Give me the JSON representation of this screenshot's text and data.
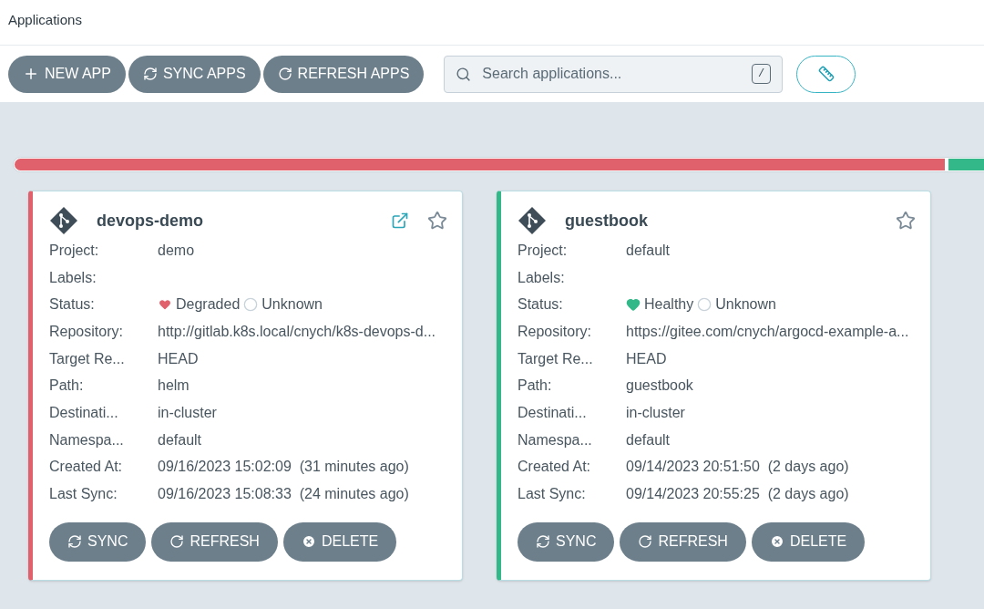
{
  "header": {
    "title": "Applications"
  },
  "toolbar": {
    "buttons": [
      {
        "kind": "new",
        "label": "NEW APP"
      },
      {
        "kind": "sync",
        "label": "SYNC APPS"
      },
      {
        "kind": "refresh",
        "label": "REFRESH APPS"
      }
    ],
    "search": {
      "placeholder": "Search applications...",
      "shortcut": "/"
    }
  },
  "health_bar": [
    {
      "color": "#e0616b",
      "level": 0.5
    },
    {
      "color": "#33b889",
      "level": 0.5
    }
  ],
  "apps": [
    {
      "name": "devops-demo",
      "color": "#e0616b",
      "external_link": true,
      "favorite": false,
      "rows": [
        {
          "kind": "text",
          "label": "Project:",
          "value": "demo"
        },
        {
          "kind": "text",
          "label": "Labels:"
        },
        {
          "kind": "status",
          "label": "Status:",
          "health": {
            "kind": "degraded",
            "label": "Degraded"
          },
          "sync": "Unknown"
        },
        {
          "kind": "text",
          "label": "Repository:",
          "value": "http://gitlab.k8s.local/cnych/k8s-devops-d..."
        },
        {
          "kind": "text",
          "label": "Target Re...",
          "value": "HEAD"
        },
        {
          "kind": "text",
          "label": "Path:",
          "value": "helm"
        },
        {
          "kind": "text",
          "label": "Destinati...",
          "value": "in-cluster"
        },
        {
          "kind": "text",
          "label": "Namespa...",
          "value": "default"
        },
        {
          "kind": "text",
          "label": "Created At:",
          "value": "09/16/2023 15:02:09  (31 minutes ago)"
        },
        {
          "kind": "text",
          "label": "Last Sync:",
          "value": "09/16/2023 15:08:33  (24 minutes ago)"
        }
      ],
      "actions": [
        {
          "kind": "sync",
          "label": "SYNC"
        },
        {
          "kind": "refresh",
          "label": "REFRESH"
        },
        {
          "kind": "delete",
          "label": "DELETE"
        }
      ]
    },
    {
      "name": "guestbook",
      "color": "#33b889",
      "external_link": false,
      "favorite": false,
      "rows": [
        {
          "kind": "text",
          "label": "Project:",
          "value": "default"
        },
        {
          "kind": "text",
          "label": "Labels:"
        },
        {
          "kind": "status",
          "label": "Status:",
          "health": {
            "kind": "healthy",
            "label": "Healthy"
          },
          "sync": "Unknown"
        },
        {
          "kind": "text",
          "label": "Repository:",
          "value": "https://gitee.com/cnych/argocd-example-a..."
        },
        {
          "kind": "text",
          "label": "Target Re...",
          "value": "HEAD"
        },
        {
          "kind": "text",
          "label": "Path:",
          "value": "guestbook"
        },
        {
          "kind": "text",
          "label": "Destinati...",
          "value": "in-cluster"
        },
        {
          "kind": "text",
          "label": "Namespa...",
          "value": "default"
        },
        {
          "kind": "text",
          "label": "Created At:",
          "value": "09/14/2023 20:51:50  (2 days ago)"
        },
        {
          "kind": "text",
          "label": "Last Sync:",
          "value": "09/14/2023 20:55:25  (2 days ago)"
        }
      ],
      "actions": [
        {
          "kind": "sync",
          "label": "SYNC"
        },
        {
          "kind": "refresh",
          "label": "REFRESH"
        },
        {
          "kind": "delete",
          "label": "DELETE"
        }
      ]
    }
  ]
}
